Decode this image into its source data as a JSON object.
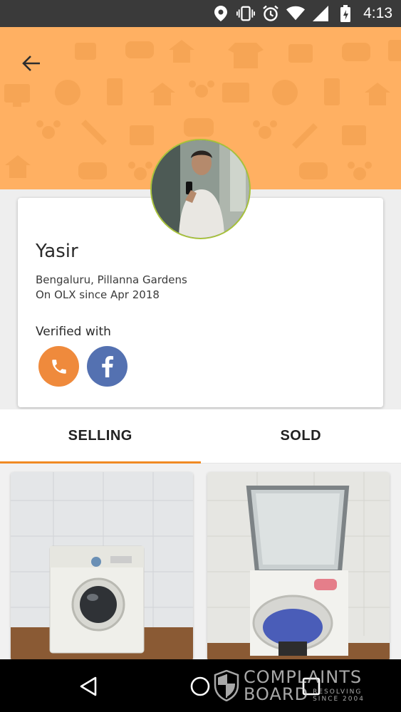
{
  "status_bar": {
    "time": "4:13"
  },
  "profile": {
    "name": "Yasir",
    "location": "Bengaluru, Pillanna Gardens",
    "member_since": "On OLX since Apr 2018",
    "verified_label": "Verified with",
    "verified_methods": [
      "phone-icon",
      "facebook-icon"
    ]
  },
  "tabs": [
    {
      "label": "SELLING",
      "active": true
    },
    {
      "label": "SOLD",
      "active": false
    }
  ],
  "listings": [
    {
      "image": "front-load-washing-machine"
    },
    {
      "image": "top-load-washing-machine"
    }
  ],
  "watermark": {
    "line1": "COMPLAINTS",
    "line2": "BOARD",
    "tagline1": "RESOLVING",
    "tagline2": "SINCE 2004"
  },
  "colors": {
    "header_bg": "#ffb062",
    "accent": "#f08a24",
    "phone_badge": "#ef8a3c",
    "facebook_badge": "#5471b1"
  }
}
